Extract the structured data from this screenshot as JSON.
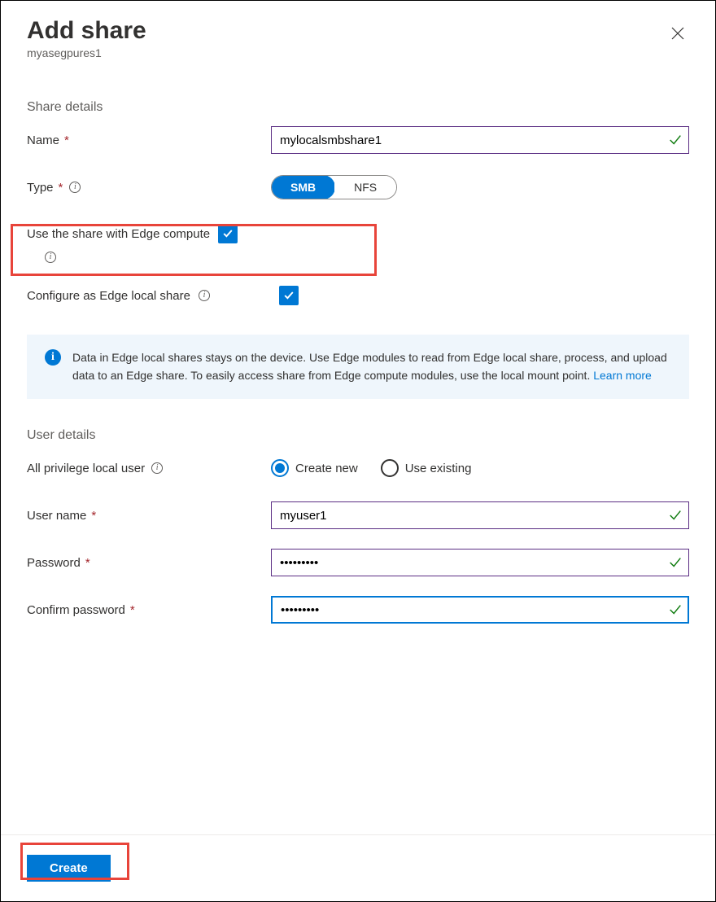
{
  "header": {
    "title": "Add share",
    "subtitle": "myasegpures1"
  },
  "share_details": {
    "heading": "Share details",
    "name_label": "Name",
    "name_value": "mylocalsmbshare1",
    "type_label": "Type",
    "type_options": {
      "smb": "SMB",
      "nfs": "NFS"
    },
    "type_selected": "SMB",
    "edge_compute_label": "Use the share with Edge compute",
    "edge_compute_checked": true,
    "edge_local_label": "Configure as Edge local share",
    "edge_local_checked": true
  },
  "info_banner": {
    "text": "Data in Edge local shares stays on the device. Use Edge modules to read from Edge local share, process, and upload data to an Edge share. To easily access share from Edge compute modules, use the local mount point. ",
    "link_text": "Learn more"
  },
  "user_details": {
    "heading": "User details",
    "all_privilege_label": "All privilege local user",
    "radio_create": "Create new",
    "radio_existing": "Use existing",
    "radio_selected": "Create new",
    "username_label": "User name",
    "username_value": "myuser1",
    "password_label": "Password",
    "password_value": "………………",
    "password_masked": "•••••••••",
    "confirm_label": "Confirm password",
    "confirm_masked": "•••••••••"
  },
  "footer": {
    "create_label": "Create"
  }
}
